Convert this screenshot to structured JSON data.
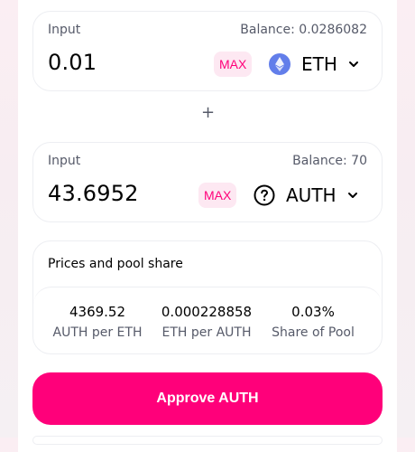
{
  "input_a": {
    "label": "Input",
    "balance": "Balance: 0.0286082",
    "amount": "0.01",
    "max_label": "MAX",
    "token_symbol": "ETH",
    "token_icon": "eth-icon"
  },
  "plus_symbol": "+",
  "input_b": {
    "label": "Input",
    "balance": "Balance: 70",
    "amount": "43.6952",
    "max_label": "MAX",
    "token_symbol": "AUTH",
    "token_icon": "question-circle-icon"
  },
  "pool": {
    "title": "Prices and pool share",
    "stats": [
      {
        "value": "4369.52",
        "label": "AUTH per ETH"
      },
      {
        "value": "0.000228858",
        "label": "ETH per AUTH"
      },
      {
        "value": "0.03%",
        "label": "Share of Pool"
      }
    ]
  },
  "approve_label": "Approve AUTH",
  "colors": {
    "accent": "#ff007a",
    "max_bg": "#fde8f2",
    "muted_text": "#565a69",
    "border": "#edeef2"
  }
}
